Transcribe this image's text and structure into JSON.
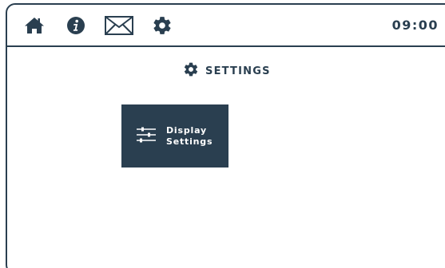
{
  "topbar": {
    "icons": [
      "home-icon",
      "info-icon",
      "mail-icon",
      "gear-icon"
    ],
    "clock": "09:00"
  },
  "page": {
    "title": "SETTINGS",
    "title_icon": "gear-icon"
  },
  "tiles": [
    {
      "icon": "sliders-icon",
      "label_line1": "Display",
      "label_line2": "Settings"
    }
  ],
  "colors": {
    "primary": "#2a3f50",
    "background": "#ffffff",
    "tile_text": "#ffffff"
  }
}
